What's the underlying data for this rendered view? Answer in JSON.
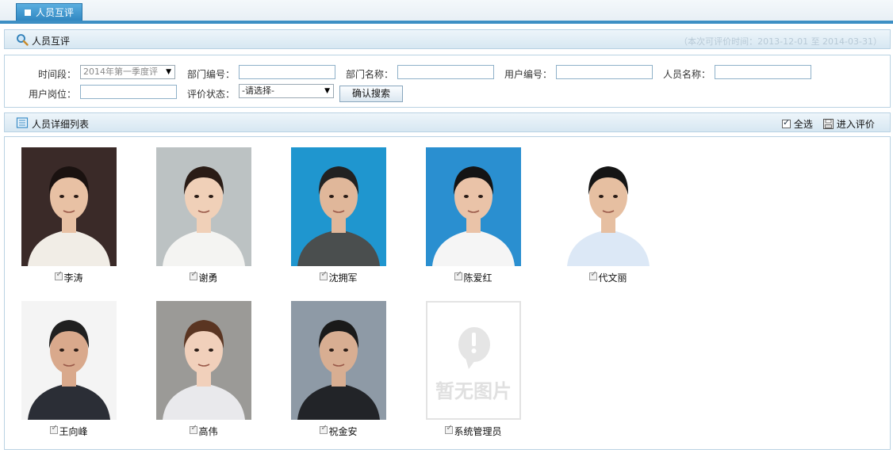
{
  "tab": {
    "label": "人员互评"
  },
  "header": {
    "title": "人员互评",
    "range_text": "（本次可评价时间：2013-12-01 至 2014-03-31）"
  },
  "filters": {
    "period_label": "时间段：",
    "period_value": "2014年第一季度评",
    "dept_code_label": "部门编号：",
    "dept_name_label": "部门名称：",
    "user_code_label": "用户编号：",
    "person_name_label": "人员名称：",
    "post_label": "用户岗位：",
    "status_label": "评价状态：",
    "status_value": "-请选择-",
    "search_button": "确认搜索"
  },
  "list": {
    "title": "人员详细列表",
    "select_all": "全选",
    "enter_eval": "进入评价"
  },
  "no_photo_text": "暂无图片",
  "people": [
    {
      "name": "李涛",
      "photo": "woman-dark-background",
      "bg": "#3a2a28",
      "skin": "#e8c1a4",
      "hair": "#1a1210",
      "shirt": "#f1ede6"
    },
    {
      "name": "谢勇",
      "photo": "woman-grey-background",
      "bg": "#bcc2c3",
      "skin": "#f0d0b8",
      "hair": "#2a1c16",
      "shirt": "#f4f4f2"
    },
    {
      "name": "沈拥军",
      "photo": "man-blue-background",
      "bg": "#1f96cf",
      "skin": "#e0b79a",
      "hair": "#222222",
      "shirt": "#4a4e4e"
    },
    {
      "name": "陈爱红",
      "photo": "man-blue-background",
      "bg": "#2a8fd0",
      "skin": "#eac3a8",
      "hair": "#141414",
      "shirt": "#f5f5f5"
    },
    {
      "name": "代文丽",
      "photo": "man-white-background",
      "bg": "#ffffff",
      "skin": "#e6bfa1",
      "hair": "#151515",
      "shirt": "#dce8f6"
    },
    {
      "name": "王向峰",
      "photo": "man-white-background",
      "bg": "#f4f4f4",
      "skin": "#d9a98c",
      "hair": "#202020",
      "shirt": "#2b2e36"
    },
    {
      "name": "高伟",
      "photo": "woman-outdoor-background",
      "bg": "#9b9a97",
      "skin": "#f1d0bb",
      "hair": "#5a3522",
      "shirt": "#e9e9ec"
    },
    {
      "name": "祝金安",
      "photo": "man-street-background",
      "bg": "#8e9aa6",
      "skin": "#d8ae92",
      "hair": "#1a1a1a",
      "shirt": "#222428"
    },
    {
      "name": "系统管理员",
      "photo": "no-photo",
      "bg": "#ffffff",
      "skin": "",
      "hair": "",
      "shirt": ""
    }
  ]
}
